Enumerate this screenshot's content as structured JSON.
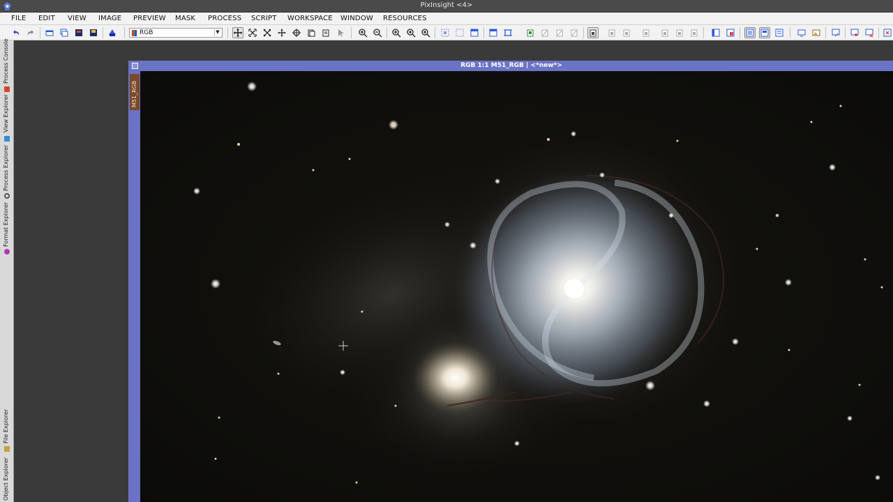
{
  "app": {
    "title": "PixInsight <4>",
    "icon": "pixinsight-logo-icon"
  },
  "menu": [
    "FILE",
    "EDIT",
    "VIEW",
    "IMAGE",
    "PREVIEW",
    "MASK",
    "PROCESS",
    "SCRIPT",
    "WORKSPACE",
    "WINDOW",
    "RESOURCES"
  ],
  "toolbar": {
    "view_select_value": "RGB",
    "icons": [
      "undo-icon",
      "redo-icon",
      "new-image-icon",
      "duplicate-icon",
      "open-icon",
      "save-icon",
      "rgb-mode-icon",
      "dynamic-pan-icon",
      "fit-view-icon",
      "zoom-to-fit-icon",
      "pan-mode-icon",
      "readout-icon",
      "sample-icon",
      "pointer-icon",
      "zoom-in-icon",
      "zoom-out-icon",
      "zoom-1-icon",
      "zoom-in-2-icon",
      "zoom-out-2-icon"
    ]
  },
  "dock": {
    "tabs": [
      {
        "label": "Process Console",
        "icon": "console-icon",
        "color": "#d24a2a"
      },
      {
        "label": "View Explorer",
        "icon": "view-explorer-icon",
        "color": "#3a8ad8"
      },
      {
        "label": "Process Explorer",
        "icon": "gear-icon",
        "color": "#555555"
      },
      {
        "label": "Format Explorer",
        "icon": "format-icon",
        "color": "#b03ab0"
      },
      {
        "label": "File Explorer",
        "icon": "folder-icon",
        "color": "#c8a040"
      },
      {
        "label": "Object Explorer",
        "icon": "object-icon",
        "color": "#40a040"
      }
    ]
  },
  "image_window": {
    "title": "RGB 1:1 M51_RGB | <*new*>",
    "id_tab": "M51_RGB"
  },
  "colors": {
    "window_accent": "#6b73c4",
    "id_tab": "#7a4a2a",
    "workspace": "#3a3a3a"
  }
}
